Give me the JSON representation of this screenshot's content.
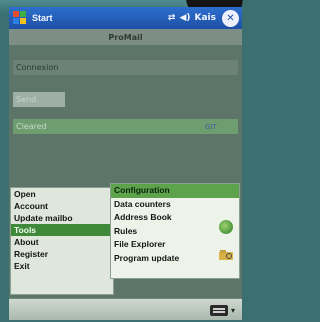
{
  "titlebar": {
    "start_label": "Start",
    "icons": [
      "connectivity-icon",
      "volume-icon"
    ],
    "mode_label": "Kais",
    "ok_label": "✕"
  },
  "app": {
    "title": "ProMail"
  },
  "form": {
    "field1": "Connexion",
    "field2": "Send",
    "field3": "Cleared",
    "field3_extra": "GIT"
  },
  "menu": {
    "items": [
      {
        "label": "Open",
        "selected": false
      },
      {
        "label": "Account",
        "selected": false
      },
      {
        "label": "Update mailbo",
        "selected": false
      },
      {
        "label": "Tools",
        "selected": true
      },
      {
        "label": "About",
        "selected": false
      },
      {
        "label": "Register",
        "selected": false
      },
      {
        "label": "Exit",
        "selected": false
      }
    ]
  },
  "submenu": {
    "items": [
      {
        "label": "Configuration",
        "selected": true
      },
      {
        "label": "Data counters",
        "selected": false
      },
      {
        "label": "Address Book",
        "selected": false,
        "icon": "earth-icon"
      },
      {
        "label": "Rules",
        "selected": false
      },
      {
        "label": "File Explorer",
        "selected": false,
        "icon": "folder-search-icon"
      },
      {
        "label": "Program update",
        "selected": false
      }
    ]
  },
  "colors": {
    "titlebar": "#1e4fa4",
    "menu_selected": "#3f8a3a",
    "submenu_selected": "#5da34b",
    "screen_bg": "#5d7568"
  }
}
